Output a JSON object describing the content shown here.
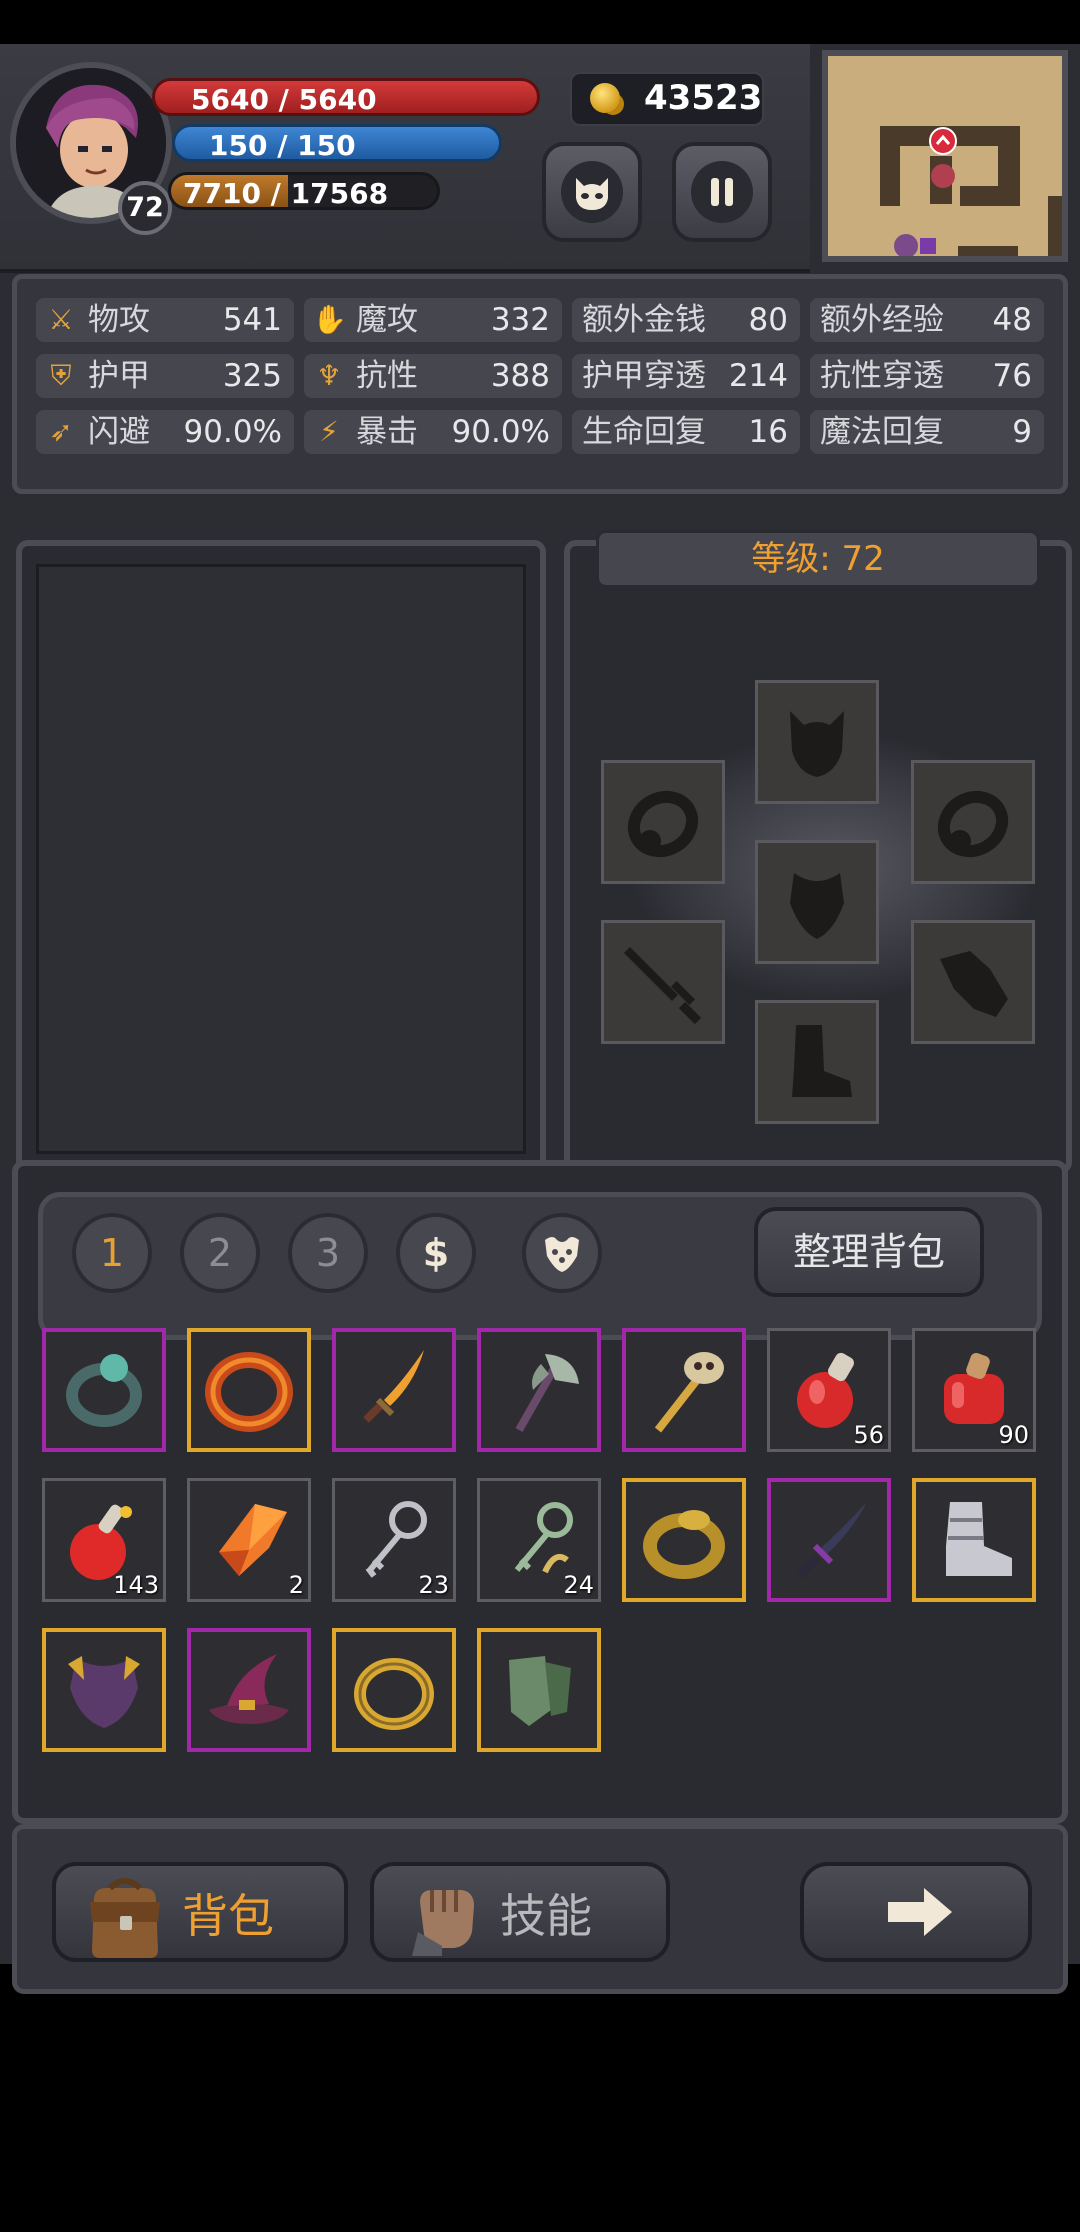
{
  "hud": {
    "hp": "5640 / 5640",
    "mp": "150 / 150",
    "xp_current": "7710",
    "xp_separator": " / ",
    "xp_max": "17568",
    "xp_fraction": 0.44,
    "level": "72",
    "gold": "43523"
  },
  "stats": [
    {
      "icon": "sword-icon",
      "label": "物攻",
      "value": "541"
    },
    {
      "icon": "magic-hand-icon",
      "label": "魔攻",
      "value": "332"
    },
    {
      "icon": "",
      "label": "额外金钱",
      "value": "80"
    },
    {
      "icon": "",
      "label": "额外经验",
      "value": "48"
    },
    {
      "icon": "armor-icon",
      "label": "护甲",
      "value": "325"
    },
    {
      "icon": "resist-icon",
      "label": "抗性",
      "value": "388"
    },
    {
      "icon": "",
      "label": "护甲穿透",
      "value": "214"
    },
    {
      "icon": "",
      "label": "抗性穿透",
      "value": "76"
    },
    {
      "icon": "running-icon",
      "label": "闪避",
      "value": "90.0%"
    },
    {
      "icon": "lightning-icon",
      "label": "暴击",
      "value": "90.0%"
    },
    {
      "icon": "",
      "label": "生命回复",
      "value": "16"
    },
    {
      "icon": "",
      "label": "魔法回复",
      "value": "9"
    }
  ],
  "equipment": {
    "level_title": "等级: 72"
  },
  "inventory": {
    "tabs": [
      "1",
      "2",
      "3",
      "$"
    ],
    "sort_label": "整理背包",
    "items": [
      {
        "name": "teal-ring",
        "rarity": "purple",
        "qty": ""
      },
      {
        "name": "fire-ring",
        "rarity": "gold",
        "qty": ""
      },
      {
        "name": "flame-dagger",
        "rarity": "purple",
        "qty": ""
      },
      {
        "name": "battle-axe",
        "rarity": "purple",
        "qty": ""
      },
      {
        "name": "skull-staff",
        "rarity": "purple",
        "qty": ""
      },
      {
        "name": "health-potion",
        "rarity": "gray",
        "qty": "56"
      },
      {
        "name": "large-health-potion",
        "rarity": "gray",
        "qty": "90"
      },
      {
        "name": "red-flask",
        "rarity": "gray",
        "qty": "143"
      },
      {
        "name": "fire-crystal",
        "rarity": "gray",
        "qty": "2"
      },
      {
        "name": "silver-key",
        "rarity": "gray",
        "qty": "23"
      },
      {
        "name": "green-key",
        "rarity": "gray",
        "qty": "24"
      },
      {
        "name": "serpent-ring",
        "rarity": "gold",
        "qty": ""
      },
      {
        "name": "dark-dagger",
        "rarity": "purple",
        "qty": ""
      },
      {
        "name": "steel-boots",
        "rarity": "gold",
        "qty": ""
      },
      {
        "name": "purple-armor",
        "rarity": "gold",
        "qty": ""
      },
      {
        "name": "wizard-hat",
        "rarity": "purple",
        "qty": ""
      },
      {
        "name": "golden-ring",
        "rarity": "gold",
        "qty": ""
      },
      {
        "name": "green-gauntlets",
        "rarity": "gold",
        "qty": ""
      }
    ]
  },
  "bottom": {
    "bag_label": "背包",
    "skill_label": "技能"
  },
  "colors": {
    "accent": "#f0a030",
    "purple_rarity": "#a128a8",
    "gold_rarity": "#e0a82a"
  }
}
